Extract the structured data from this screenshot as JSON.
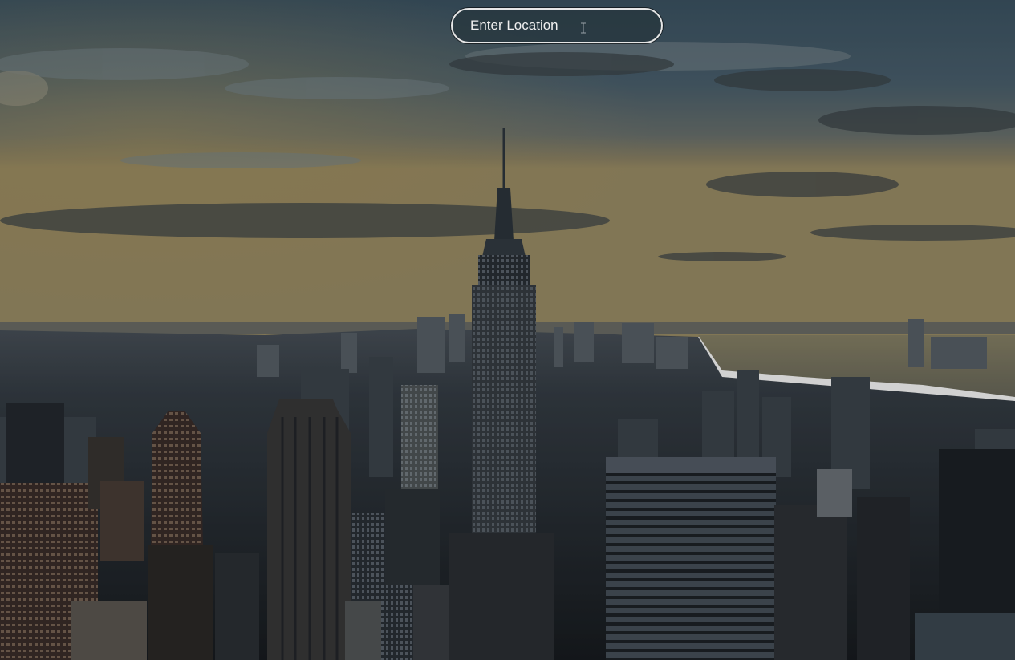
{
  "search": {
    "placeholder": "Enter Location",
    "value": ""
  },
  "background": {
    "scene": "city-skyline-photo"
  },
  "colors": {
    "field_border": "#e6e6e6",
    "field_text": "#efefef",
    "field_fill": "#26343c"
  },
  "icons": {
    "cursor": "text-cursor-icon"
  }
}
